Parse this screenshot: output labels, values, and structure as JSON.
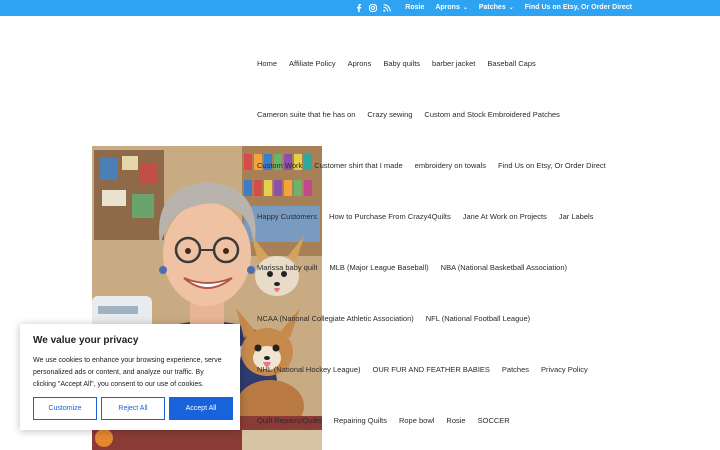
{
  "topbar": {
    "social_icons": [
      "facebook-icon",
      "instagram-icon",
      "rss-icon"
    ],
    "links": [
      {
        "label": "Rosie",
        "dropdown": false
      },
      {
        "label": "Aprons",
        "dropdown": true
      },
      {
        "label": "Patches",
        "dropdown": true
      },
      {
        "label": "Find Us on Etsy, Or Order Direct",
        "dropdown": false
      }
    ],
    "accent_color": "#2ea3f2"
  },
  "menu": {
    "rows": [
      [
        "Home",
        "Affiliate Policy",
        "Aprons",
        "Baby quilts",
        "barber jacket",
        "Baseball Caps"
      ],
      [
        "Cameron suite that he has on",
        "Crazy sewing",
        "Custom and Stock Embroidered Patches"
      ],
      [
        "Custom Work",
        "Customer shirt that I made",
        "embroidery on towals",
        "Find Us on Etsy, Or Order Direct"
      ],
      [
        "Happy Customers",
        "How to Purchase From Crazy4Quilts",
        "Jane At Work on Projects",
        "Jar Labels"
      ],
      [
        "Marissa baby quilt",
        "MLB (Major League Baseball)",
        "NBA (National Basketball Association)"
      ],
      [
        "NCAA (National Collegiate Athletic Association)",
        "NFL (National Football League)"
      ],
      [
        "NHL (National Hockey League)",
        "OUR FUR AND FEATHER BABIES",
        "Patches",
        "Privacy Policy"
      ],
      [
        "Quilt Repairs/Quilts",
        "Repairing Quilts",
        "Rope bowl",
        "Rosie",
        "SOCCER"
      ]
    ]
  },
  "consent": {
    "title": "We value your privacy",
    "body": "We use cookies to enhance your browsing experience, serve personalized ads or content, and analyze our traffic. By clicking \"Accept All\", you consent to our use of cookies.",
    "customize_label": "Customize",
    "reject_label": "Reject All",
    "accept_label": "Accept All",
    "button_color": "#1863dc"
  }
}
